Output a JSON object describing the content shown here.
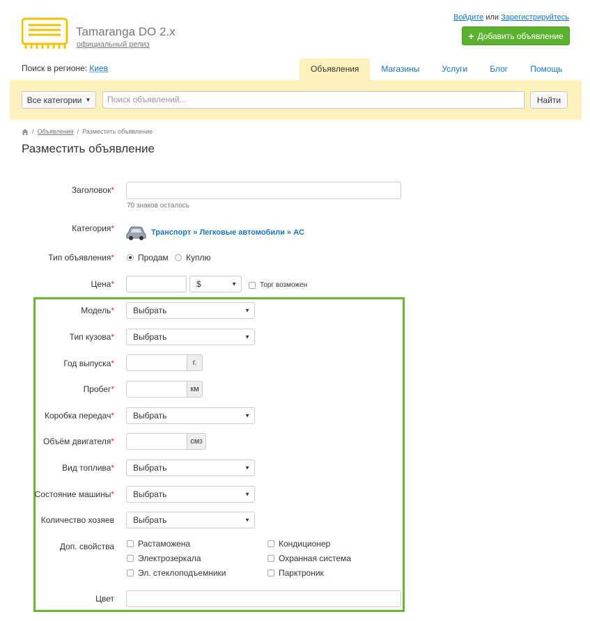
{
  "header": {
    "site_title": "Tamaranga DO 2.x",
    "site_subtitle": "официальный релиз",
    "login_link": "Войдите",
    "or_text": "или",
    "register_link": "Зарегистрируйтесь",
    "add_button": "Добавить объявление"
  },
  "region": {
    "label": "Поиск в регионе:",
    "value": "Киев"
  },
  "nav": {
    "tabs": [
      {
        "label": "Объявления",
        "active": true
      },
      {
        "label": "Магазины"
      },
      {
        "label": "Услуги"
      },
      {
        "label": "Блог"
      },
      {
        "label": "Помощь"
      }
    ]
  },
  "search": {
    "categories_button": "Все категории",
    "placeholder": "Поиск объявлений...",
    "find_button": "Найти"
  },
  "breadcrumb": {
    "items": [
      "Объявления",
      "Разместить объявление"
    ]
  },
  "page_title": "Разместить объявление",
  "form": {
    "title": {
      "label": "Заголовок",
      "value": "",
      "hint": "70 знаков осталось"
    },
    "category": {
      "label": "Категория",
      "value": "Транспорт » Легковые автомобили » AC"
    },
    "type": {
      "label": "Тип объявления",
      "options": [
        "Продам",
        "Куплю"
      ],
      "selected": "Продам"
    },
    "price": {
      "label": "Цена",
      "value": "",
      "currency": "$",
      "bargain_label": "Торг возможен"
    },
    "model": {
      "label": "Модель",
      "value": "Выбрать"
    },
    "body_type": {
      "label": "Тип кузова",
      "value": "Выбрать"
    },
    "year": {
      "label": "Год выпуска",
      "value": "",
      "unit": "г."
    },
    "mileage": {
      "label": "Пробег",
      "value": "",
      "unit": "км"
    },
    "gearbox": {
      "label": "Коробка передач",
      "value": "Выбрать"
    },
    "engine": {
      "label": "Объём двигателя",
      "value": "",
      "unit": "см",
      "unit_sup": "3"
    },
    "fuel": {
      "label": "Вид топлива",
      "value": "Выбрать"
    },
    "condition": {
      "label": "Состояние машины",
      "value": "Выбрать"
    },
    "owners": {
      "label": "Количество хозяев",
      "value": "Выбрать"
    },
    "extras": {
      "label": "Доп. свойства",
      "options": [
        "Растаможена",
        "Кондиционер",
        "Электрозеркала",
        "Охранная система",
        "Эл. стеклоподъемники",
        "Парктроник"
      ]
    },
    "color": {
      "label": "Цвет",
      "value": ""
    },
    "required_mark": "*"
  },
  "colors": {
    "accent_green": "#5cb230",
    "highlight_yellow": "#fcf1bd",
    "link_blue": "#1a73b8",
    "frame_green": "#6ab532"
  }
}
